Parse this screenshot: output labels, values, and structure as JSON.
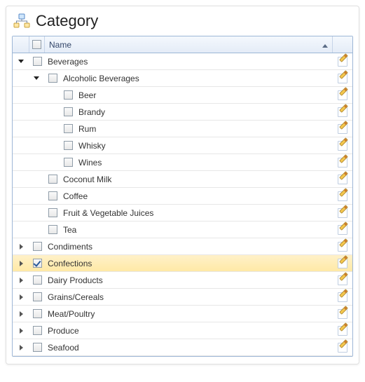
{
  "title": "Category",
  "grid": {
    "columns": {
      "name_label": "Name",
      "sort_dir": "asc"
    },
    "rows": [
      {
        "level": 0,
        "expand": "open",
        "checked": false,
        "label": "Beverages",
        "editable": true,
        "selected": false
      },
      {
        "level": 1,
        "expand": "open",
        "checked": false,
        "label": "Alcoholic Beverages",
        "editable": true,
        "selected": false
      },
      {
        "level": 2,
        "expand": "none",
        "checked": false,
        "label": "Beer",
        "editable": true,
        "selected": false
      },
      {
        "level": 2,
        "expand": "none",
        "checked": false,
        "label": "Brandy",
        "editable": true,
        "selected": false
      },
      {
        "level": 2,
        "expand": "none",
        "checked": false,
        "label": "Rum",
        "editable": true,
        "selected": false
      },
      {
        "level": 2,
        "expand": "none",
        "checked": false,
        "label": "Whisky",
        "editable": true,
        "selected": false
      },
      {
        "level": 2,
        "expand": "none",
        "checked": false,
        "label": "Wines",
        "editable": true,
        "selected": false
      },
      {
        "level": 1,
        "expand": "none",
        "checked": false,
        "label": "Coconut Milk",
        "editable": true,
        "selected": false
      },
      {
        "level": 1,
        "expand": "none",
        "checked": false,
        "label": "Coffee",
        "editable": true,
        "selected": false
      },
      {
        "level": 1,
        "expand": "none",
        "checked": false,
        "label": "Fruit & Vegetable Juices",
        "editable": true,
        "selected": false
      },
      {
        "level": 1,
        "expand": "none",
        "checked": false,
        "label": "Tea",
        "editable": true,
        "selected": false
      },
      {
        "level": 0,
        "expand": "closed",
        "checked": false,
        "label": "Condiments",
        "editable": true,
        "selected": false
      },
      {
        "level": 0,
        "expand": "closed",
        "checked": true,
        "label": "Confections",
        "editable": true,
        "selected": true
      },
      {
        "level": 0,
        "expand": "closed",
        "checked": false,
        "label": "Dairy Products",
        "editable": true,
        "selected": false
      },
      {
        "level": 0,
        "expand": "closed",
        "checked": false,
        "label": "Grains/Cereals",
        "editable": true,
        "selected": false
      },
      {
        "level": 0,
        "expand": "closed",
        "checked": false,
        "label": "Meat/Poultry",
        "editable": true,
        "selected": false
      },
      {
        "level": 0,
        "expand": "closed",
        "checked": false,
        "label": "Produce",
        "editable": true,
        "selected": false
      },
      {
        "level": 0,
        "expand": "closed",
        "checked": false,
        "label": "Seafood",
        "editable": true,
        "selected": false
      }
    ]
  },
  "icons": {
    "title": "sitemap-icon",
    "edit": "edit-pencil-icon"
  },
  "colors": {
    "header_grad_top": "#f4f8fd",
    "header_grad_bot": "#e4ecf7",
    "border": "#9db6d6",
    "selected_grad_top": "#fff1c9",
    "selected_grad_bot": "#ffe9a6"
  }
}
